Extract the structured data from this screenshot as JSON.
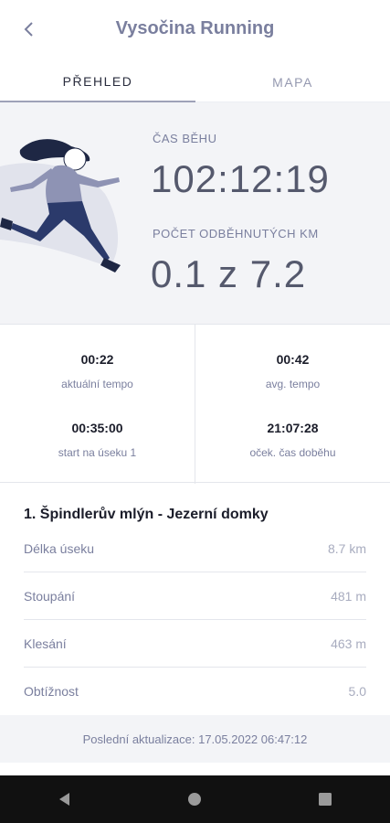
{
  "header": {
    "title": "Vysočina Running",
    "back_icon": "chevron-left-icon"
  },
  "tabs": [
    {
      "label": "PŘEHLED",
      "active": true
    },
    {
      "label": "MAPA",
      "active": false
    }
  ],
  "hero": {
    "illustration": "runner-illustration",
    "time_label": "ČAS BĚHU",
    "time_value": "102:12:19",
    "km_label": "POČET ODBĚHNUTÝCH KM",
    "km_value": "0.1 z 7.2"
  },
  "stats": [
    {
      "value": "00:22",
      "label": "aktuální tempo"
    },
    {
      "value": "00:42",
      "label": "avg. tempo"
    },
    {
      "value": "00:35:00",
      "label": "start na úseku 1"
    },
    {
      "value": "21:07:28",
      "label": "oček. čas doběhu"
    }
  ],
  "section": {
    "title": "1. Špindlerův mlýn - Jezerní domky",
    "rows": [
      {
        "label": "Délka úseku",
        "value": "8.7 km"
      },
      {
        "label": "Stoupání",
        "value": "481 m"
      },
      {
        "label": "Klesání",
        "value": "463 m"
      },
      {
        "label": "Obtížnost",
        "value": "5.0"
      }
    ]
  },
  "footer": {
    "text": "Poslední aktualizace: 17.05.2022 06:47:12"
  },
  "navbar": {
    "icons": [
      "back-triangle-icon",
      "home-circle-icon",
      "recents-square-icon"
    ]
  },
  "colors": {
    "accent": "#7a7f9e",
    "hero_bg": "#f3f4f7",
    "runner_hair": "#1e2744",
    "runner_shirt": "#8e93b4",
    "runner_pants": "#2b3a6b"
  }
}
